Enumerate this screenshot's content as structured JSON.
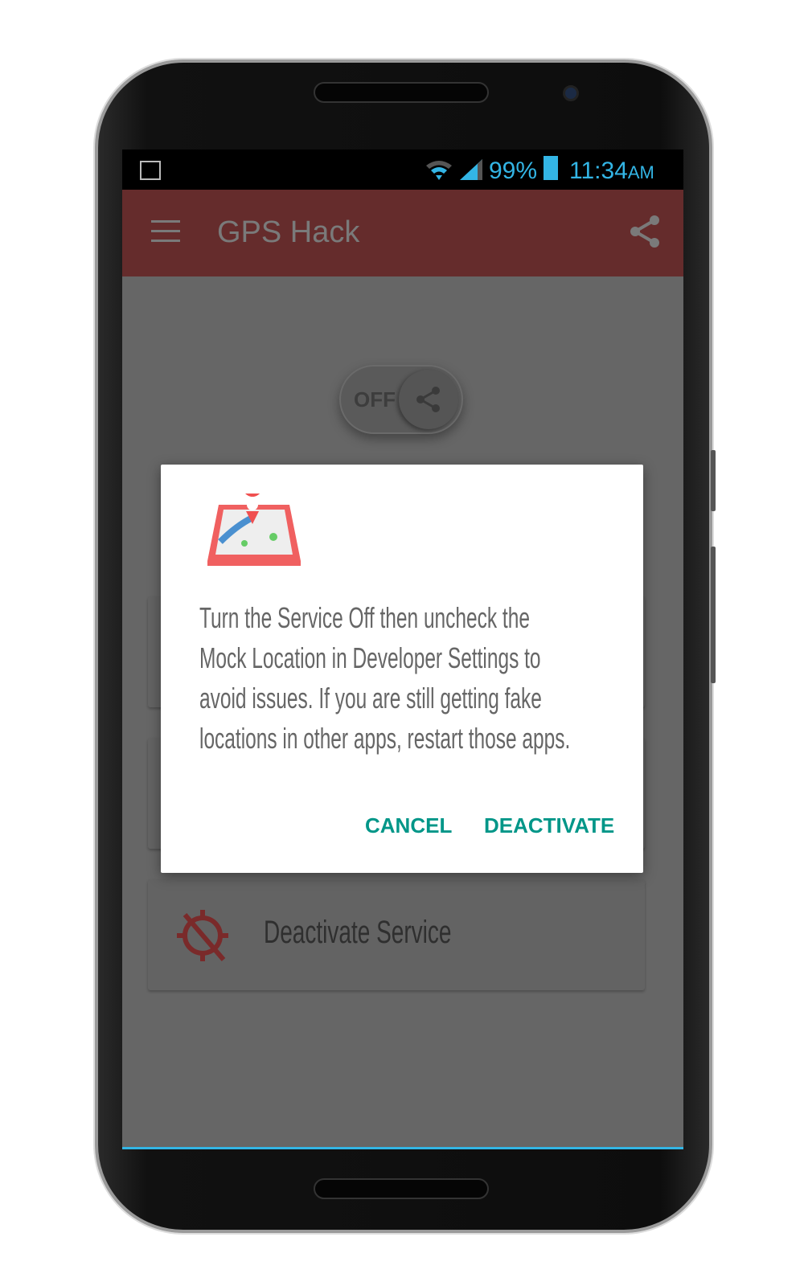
{
  "status_bar": {
    "battery": "99%",
    "time": "11:34",
    "ampm": "AM",
    "accent": "#33b5e5"
  },
  "app_bar": {
    "title": "GPS Hack",
    "color": "#652c2c"
  },
  "toggle": {
    "label": "OFF",
    "state": "off"
  },
  "cards": [
    {
      "label": "Deactivate Service",
      "icon": "gps-off-icon"
    }
  ],
  "dialog": {
    "icon": "map-pin-icon",
    "message": "Turn the Service Off then uncheck the Mock Location in Developer Settings to avoid issues. If you are still getting fake locations in other apps, restart those apps.",
    "cancel": "CANCEL",
    "confirm": "DEACTIVATE",
    "button_color": "#009688"
  }
}
